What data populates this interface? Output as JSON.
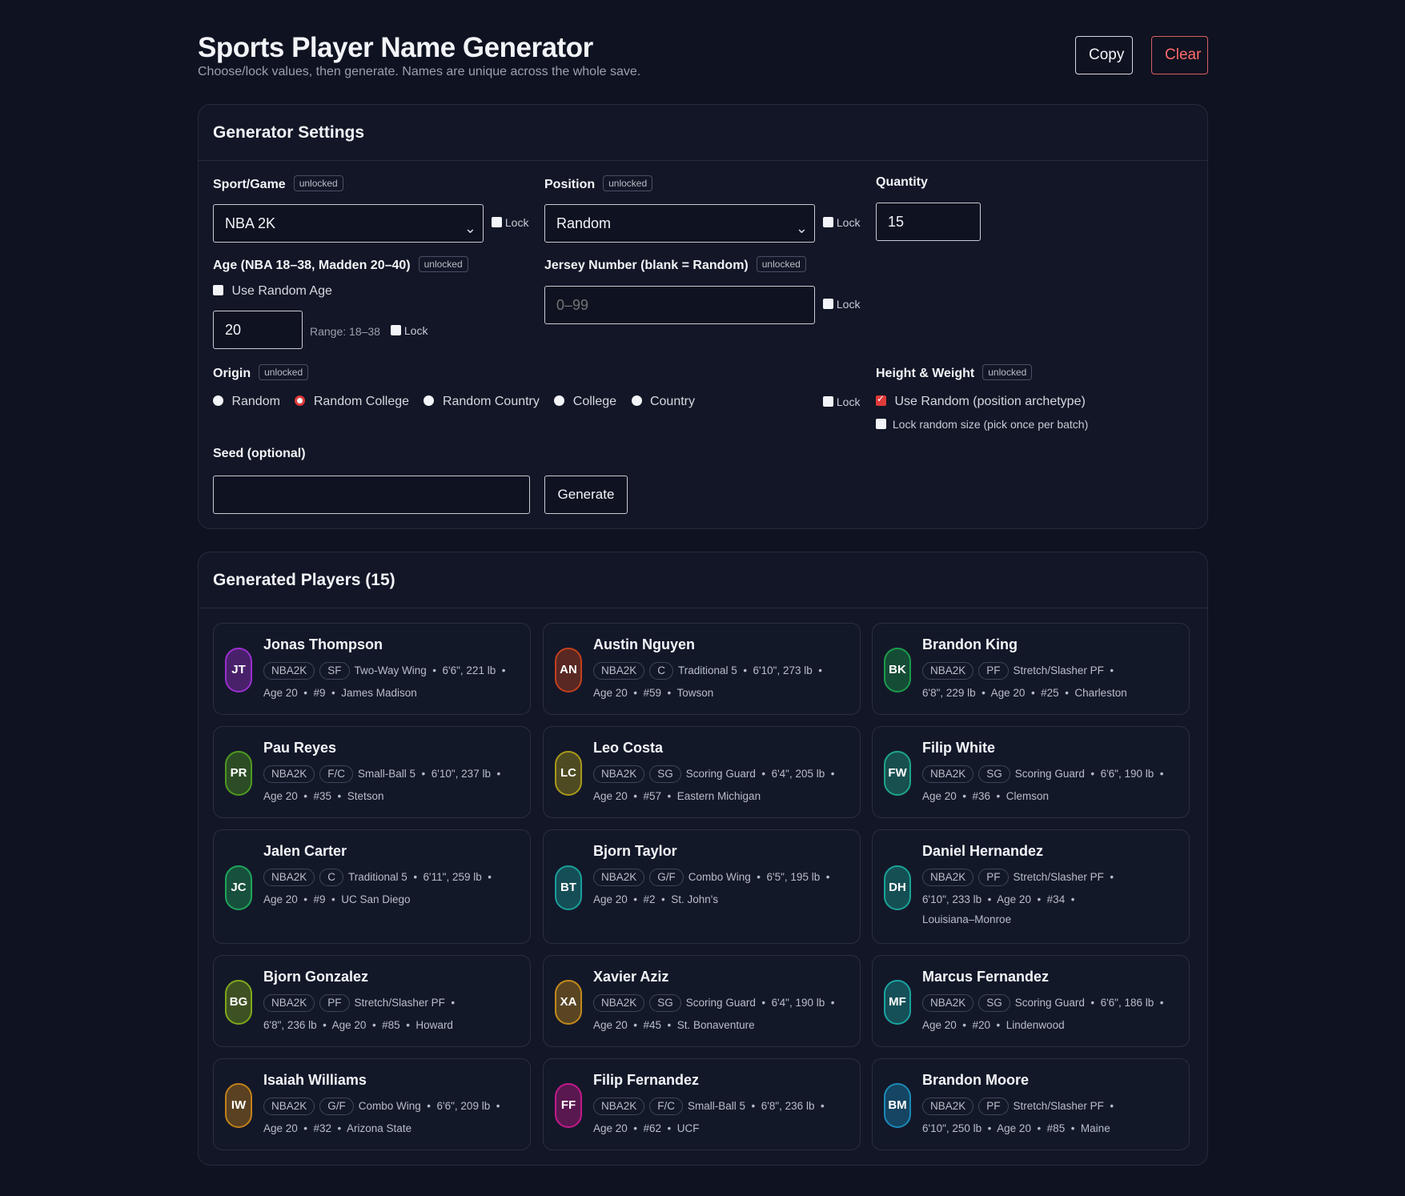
{
  "header": {
    "title": "Sports Player Name Generator",
    "subtitle": "Choose/lock values, then generate. Names are unique across the whole save.",
    "copy_label": "Copy",
    "clear_label": "Clear"
  },
  "settings": {
    "title": "Generator Settings",
    "sport_label": "Sport/Game",
    "sport_badge": "unlocked",
    "sport_value": "NBA 2K",
    "position_label": "Position",
    "position_badge": "unlocked",
    "position_value": "Random",
    "quantity_label": "Quantity",
    "quantity_value": "15",
    "lock_label": "Lock",
    "age_label": "Age (NBA 18–38, Madden 20–40)",
    "age_badge": "unlocked",
    "random_age_label": "Use Random Age",
    "age_value": "20",
    "age_range": "Range: 18–38",
    "jersey_label": "Jersey Number (blank = Random)",
    "jersey_badge": "unlocked",
    "jersey_placeholder": "0–99",
    "origin_label": "Origin",
    "origin_badge": "unlocked",
    "origin_options": [
      "Random",
      "Random College",
      "Random Country",
      "College",
      "Country"
    ],
    "origin_selected": "Random College",
    "hw_label": "Height & Weight",
    "hw_badge": "unlocked",
    "hw_random_label": "Use Random (position archetype)",
    "hw_lock_size_label": "Lock random size (pick once per batch)",
    "seed_label": "Seed (optional)",
    "seed_value": "",
    "generate_label": "Generate",
    "accent_color": "#e03a3a"
  },
  "players_section": {
    "title": "Generated Players (15)",
    "players": [
      {
        "initials": "JT",
        "name": "Jonas Thompson",
        "game": "NBA2K",
        "pos": "SF",
        "line1_rest": "Two-Way Wing  •  6'6\", 221 lb  •",
        "line2": "Age 20  •  #9  •  James Madison",
        "line3": "",
        "color": "#9b2fd0"
      },
      {
        "initials": "AN",
        "name": "Austin Nguyen",
        "game": "NBA2K",
        "pos": "C",
        "line1_rest": "Traditional 5  •  6'10\", 273 lb  •",
        "line2": "Age 20  •  #59  •  Towson",
        "line3": "",
        "color": "#c2401c"
      },
      {
        "initials": "BK",
        "name": "Brandon King",
        "game": "NBA2K",
        "pos": "PF",
        "line1_rest": "Stretch/Slasher PF  •",
        "line2": "6'8\", 229 lb  •  Age 20  •  #25  •  Charleston",
        "line3": "",
        "color": "#1a9c4a"
      },
      {
        "initials": "PR",
        "name": "Pau Reyes",
        "game": "NBA2K",
        "pos": "F/C",
        "line1_rest": "Small-Ball 5  •  6'10\", 237 lb  •",
        "line2": "Age 20  •  #35  •  Stetson",
        "line3": "",
        "color": "#4f9a1f"
      },
      {
        "initials": "LC",
        "name": "Leo Costa",
        "game": "NBA2K",
        "pos": "SG",
        "line1_rest": "Scoring Guard  •  6'4\", 205 lb  •",
        "line2": "Age 20  •  #57  •  Eastern Michigan",
        "line3": "",
        "color": "#a8991a"
      },
      {
        "initials": "FW",
        "name": "Filip White",
        "game": "NBA2K",
        "pos": "SG",
        "line1_rest": "Scoring Guard  •  6'6\", 190 lb  •",
        "line2": "Age 20  •  #36  •  Clemson",
        "line3": "",
        "color": "#1ea68a"
      },
      {
        "initials": "JC",
        "name": "Jalen Carter",
        "game": "NBA2K",
        "pos": "C",
        "line1_rest": "Traditional 5  •  6'11\", 259 lb  •",
        "line2": "Age 20  •  #9  •  UC San Diego",
        "line3": "",
        "color": "#1ea65a"
      },
      {
        "initials": "BT",
        "name": "Bjorn Taylor",
        "game": "NBA2K",
        "pos": "G/F",
        "line1_rest": "Combo Wing  •  6'5\", 195 lb  •",
        "line2": "Age 20  •  #2  •  St. John's",
        "line3": "",
        "color": "#1a9f9a"
      },
      {
        "initials": "DH",
        "name": "Daniel Hernandez",
        "game": "NBA2K",
        "pos": "PF",
        "line1_rest": "Stretch/Slasher PF  •",
        "line2": "6'10\", 233 lb  •  Age 20  •  #34  •",
        "line3": "Louisiana–Monroe",
        "color": "#1aa397"
      },
      {
        "initials": "BG",
        "name": "Bjorn Gonzalez",
        "game": "NBA2K",
        "pos": "PF",
        "line1_rest": "Stretch/Slasher PF  •",
        "line2": "6'8\", 236 lb  •  Age 20  •  #85  •  Howard",
        "line3": "",
        "color": "#7fa81a"
      },
      {
        "initials": "XA",
        "name": "Xavier Aziz",
        "game": "NBA2K",
        "pos": "SG",
        "line1_rest": "Scoring Guard  •  6'4\", 190 lb  •",
        "line2": "Age 20  •  #45  •  St. Bonaventure",
        "line3": "",
        "color": "#c28a1a"
      },
      {
        "initials": "MF",
        "name": "Marcus Fernandez",
        "game": "NBA2K",
        "pos": "SG",
        "line1_rest": "Scoring Guard  •  6'6\", 186 lb  •",
        "line2": "Age 20  •  #20  •  Lindenwood",
        "line3": "",
        "color": "#1aa3a0"
      },
      {
        "initials": "IW",
        "name": "Isaiah Williams",
        "game": "NBA2K",
        "pos": "G/F",
        "line1_rest": "Combo Wing  •  6'6\", 209 lb  •",
        "line2": "Age 20  •  #32  •  Arizona State",
        "line3": "",
        "color": "#c2801a"
      },
      {
        "initials": "FF",
        "name": "Filip Fernandez",
        "game": "NBA2K",
        "pos": "F/C",
        "line1_rest": "Small-Ball 5  •  6'8\", 236 lb  •",
        "line2": "Age 20  •  #62  •  UCF",
        "line3": "",
        "color": "#c21a8a"
      },
      {
        "initials": "BM",
        "name": "Brandon Moore",
        "game": "NBA2K",
        "pos": "PF",
        "line1_rest": "Stretch/Slasher PF  •",
        "line2": "6'10\", 250 lb  •  Age 20  •  #85  •  Maine",
        "line3": "",
        "color": "#1a8ab8"
      }
    ]
  }
}
